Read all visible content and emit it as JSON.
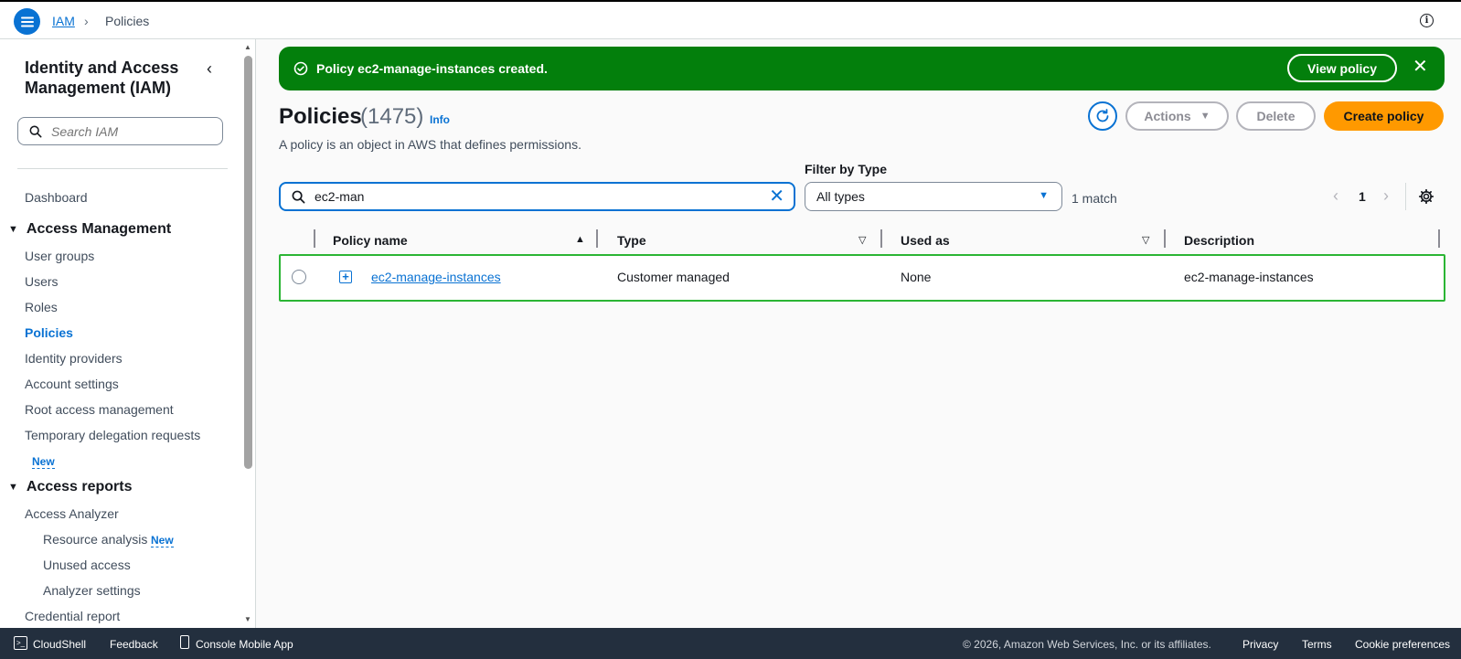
{
  "topbar": {
    "breadcrumb_root": "IAM",
    "breadcrumb_current": "Policies"
  },
  "sidebar": {
    "title": "Identity and Access Management (IAM)",
    "search_placeholder": "Search IAM",
    "dashboard": "Dashboard",
    "section_access_management": "Access Management",
    "items": [
      {
        "label": "User groups"
      },
      {
        "label": "Users"
      },
      {
        "label": "Roles"
      },
      {
        "label": "Policies"
      },
      {
        "label": "Identity providers"
      },
      {
        "label": "Account settings"
      },
      {
        "label": "Root access management"
      },
      {
        "label": "Temporary delegation requests"
      }
    ],
    "new_badge": "New",
    "section_access_reports": "Access reports",
    "reports": [
      {
        "label": "Access Analyzer"
      },
      {
        "label": "Resource analysis"
      },
      {
        "label": "Unused access"
      },
      {
        "label": "Analyzer settings"
      },
      {
        "label": "Credential report"
      }
    ]
  },
  "flash": {
    "message": "Policy ec2-manage-instances created.",
    "action": "View policy",
    "close": "✕",
    "color": "#037f0c"
  },
  "header": {
    "title": "Policies",
    "count": "(1475)",
    "info": "Info",
    "description": "A policy is an object in AWS that defines permissions."
  },
  "toolbar": {
    "actions_label": "Actions",
    "delete_label": "Delete",
    "create_label": "Create policy"
  },
  "filter": {
    "search_value": "ec2-man",
    "type_label": "Filter by Type",
    "type_value": "All types",
    "match_count": "1 match"
  },
  "pagination": {
    "current_page": "1",
    "prev": "‹",
    "next": "›"
  },
  "table": {
    "columns": [
      "Policy name",
      "Type",
      "Used as",
      "Description"
    ],
    "rows": [
      {
        "name": "ec2-manage-instances",
        "type": "Customer managed",
        "used_as": "None",
        "description": "ec2-manage-instances"
      }
    ]
  },
  "footer": {
    "cloudshell": "CloudShell",
    "feedback": "Feedback",
    "mobile_app": "Console Mobile App",
    "copyright": "© 2026, Amazon Web Services, Inc. or its affiliates.",
    "privacy": "Privacy",
    "terms": "Terms",
    "cookies": "Cookie preferences"
  },
  "colors": {
    "accent": "#0972d3",
    "primary_button": "#ff9900",
    "footer_bg": "#232f3e",
    "row_highlight": "#2bb534"
  },
  "icons": [
    "menu-icon",
    "chevron-right-icon",
    "info-icon",
    "chevron-left-icon",
    "search-icon",
    "caret-down-icon",
    "check-circle-icon",
    "close-icon",
    "refresh-icon",
    "sort-ascending-icon",
    "sort-icon",
    "expand-icon",
    "settings-icon",
    "terminal-icon",
    "mobile-icon"
  ]
}
